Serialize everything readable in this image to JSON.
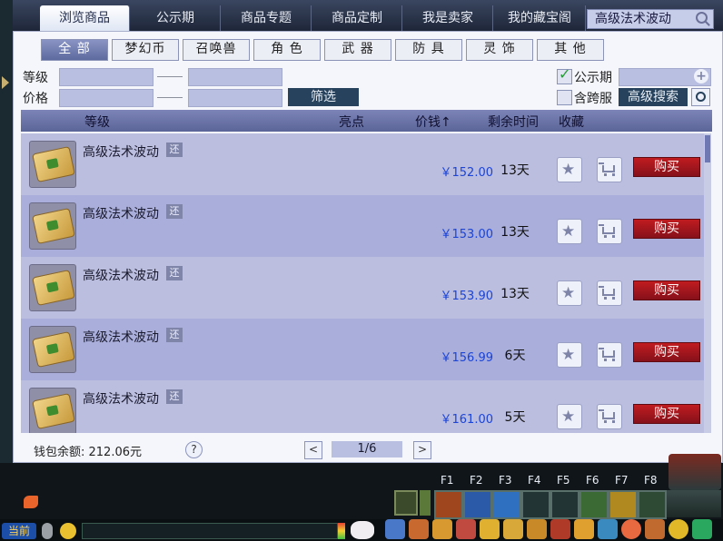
{
  "tabs": [
    {
      "label": "浏览商品",
      "active": true
    },
    {
      "label": "公示期"
    },
    {
      "label": "商品专题"
    },
    {
      "label": "商品定制"
    },
    {
      "label": "我是卖家"
    },
    {
      "label": "我的藏宝阁"
    }
  ],
  "search": {
    "value": "高级法术波动"
  },
  "categories": [
    "全 部",
    "梦幻币",
    "召唤兽",
    "角 色",
    "武 器",
    "防 具",
    "灵 饰",
    "其 他"
  ],
  "filters": {
    "level_label": "等级",
    "price_label": "价格",
    "filter_button": "筛选",
    "announce_label": "公示期",
    "announce_checked": true,
    "cross_server_label": "含跨服",
    "advanced_search": "高级搜索"
  },
  "table": {
    "headers": {
      "level": "等级",
      "highlight": "亮点",
      "price": "价钱↑",
      "time": "剩余时间",
      "favorite": "收藏"
    },
    "rows": [
      {
        "name": "高级法术波动",
        "badge": "还",
        "price": "￥152.00",
        "time": "13天",
        "buy": "购买"
      },
      {
        "name": "高级法术波动",
        "badge": "还",
        "price": "￥153.00",
        "time": "13天",
        "buy": "购买"
      },
      {
        "name": "高级法术波动",
        "badge": "还",
        "price": "￥153.90",
        "time": "13天",
        "buy": "购买"
      },
      {
        "name": "高级法术波动",
        "badge": "还",
        "price": "￥156.99",
        "time": "6天",
        "buy": "购买"
      },
      {
        "name": "高级法术波动",
        "badge": "还",
        "price": "￥161.00",
        "time": "5天",
        "buy": "购买"
      }
    ]
  },
  "footer": {
    "wallet": "钱包余额: 212.06元",
    "help": "?",
    "page": "1/6",
    "prev": "<",
    "next": ">"
  },
  "hud": {
    "fkeys": [
      "F1",
      "F2",
      "F3",
      "F4",
      "F5",
      "F6",
      "F7",
      "F8"
    ],
    "chat_channel": "当前"
  },
  "colors": {
    "price": "#1c44d8",
    "buy_button": "#a8141c",
    "header_bg": "#6c74aa",
    "row_bg": "#b3b7dd"
  }
}
